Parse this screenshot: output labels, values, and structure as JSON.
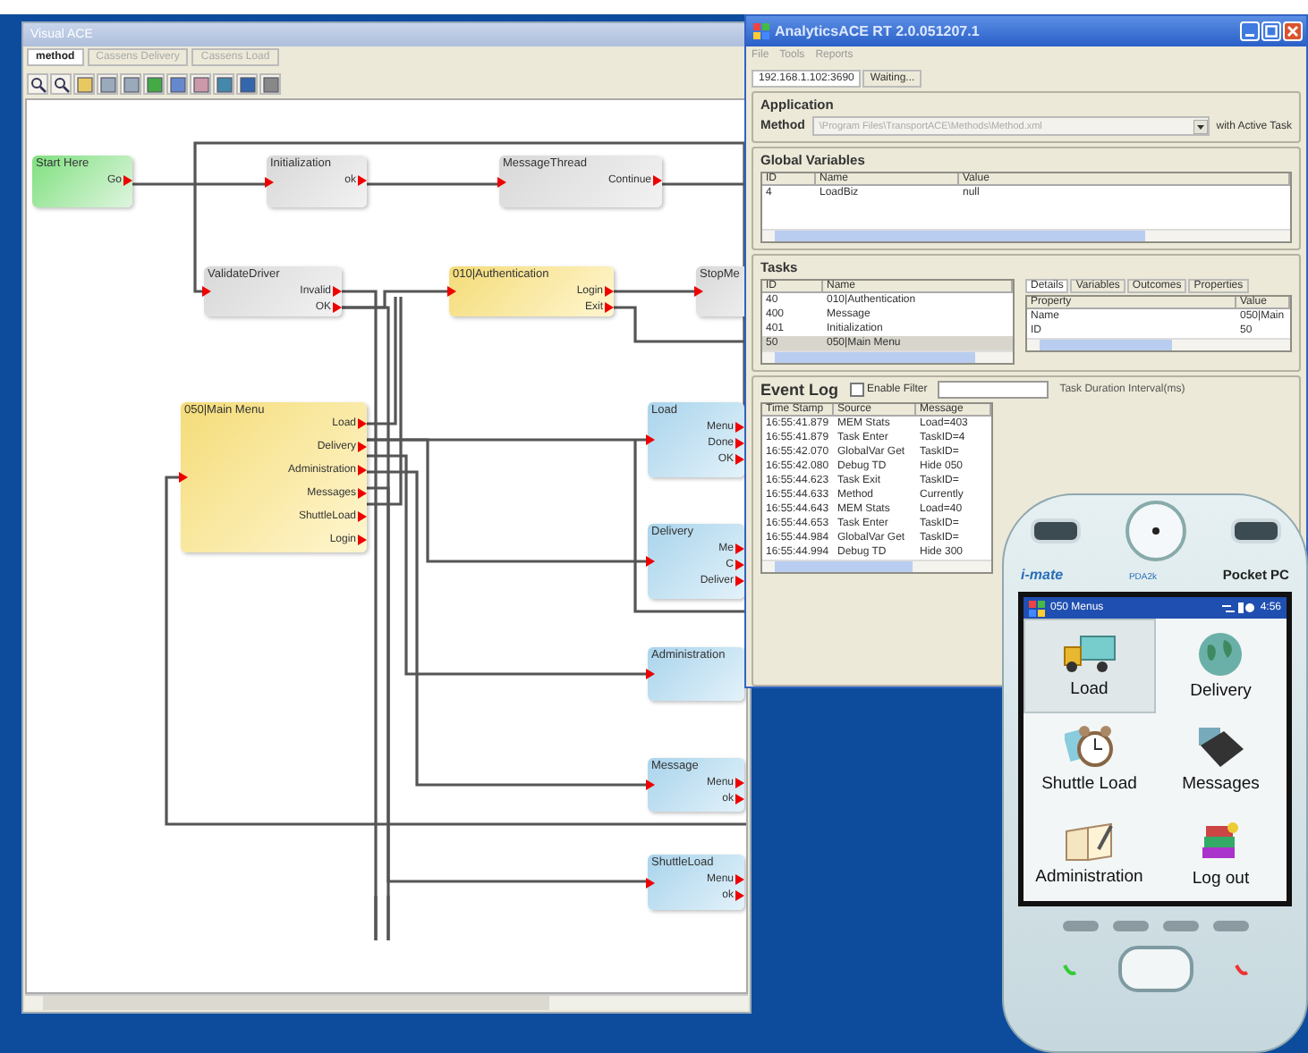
{
  "designer": {
    "title": "Visual ACE",
    "tabs": [
      {
        "label": "method",
        "selected": true
      },
      {
        "label": "Cassens Delivery",
        "selected": false
      },
      {
        "label": "Cassens Load",
        "selected": false
      }
    ],
    "nodes": [
      {
        "title": "Start Here",
        "kind": "start",
        "ports": [
          "Go"
        ]
      },
      {
        "title": "Initialization",
        "kind": "task",
        "ports": [
          "ok"
        ]
      },
      {
        "title": "MessageThread",
        "kind": "task",
        "ports": [
          "Continue"
        ]
      },
      {
        "title": "ValidateDriver",
        "kind": "task",
        "ports": [
          "Invalid",
          "OK"
        ]
      },
      {
        "title": "010|Authentication",
        "kind": "menu",
        "ports": [
          "Login",
          "Exit"
        ]
      },
      {
        "title": "StopMe",
        "kind": "task"
      },
      {
        "title": "050|Main Menu",
        "kind": "menu",
        "ports": [
          "Load",
          "Delivery",
          "Administration",
          "Messages",
          "ShuttleLoad",
          "Login"
        ]
      },
      {
        "title": "Load",
        "kind": "screen",
        "ports": [
          "Menu",
          "Done",
          "OK"
        ]
      },
      {
        "title": "Delivery",
        "kind": "screen",
        "ports": [
          "Me",
          "C",
          "Deliver"
        ]
      },
      {
        "title": "Administration",
        "kind": "screen"
      },
      {
        "title": "Message",
        "kind": "screen",
        "ports": [
          "Menu",
          "ok"
        ]
      },
      {
        "title": "ShuttleLoad",
        "kind": "screen",
        "ports": [
          "Menu",
          "ok"
        ]
      }
    ]
  },
  "runtime": {
    "title": "AnalyticsACE RT 2.0.051207.1",
    "menu": [
      "File",
      "Tools",
      "Reports"
    ],
    "status_tabs": [
      {
        "label": "192.168.1.102:3690",
        "selected": true
      },
      {
        "label": "Waiting...",
        "selected": false
      }
    ],
    "application": {
      "heading": "Application",
      "method_label": "Method",
      "method_value": "\\Program Files\\TransportACE\\Methods\\Method.xml",
      "suffix": "with Active Task"
    },
    "global_variables": {
      "heading": "Global Variables",
      "columns": [
        "ID",
        "Name",
        "Value"
      ],
      "rows": [
        [
          "4",
          "LoadBiz",
          "null"
        ]
      ]
    },
    "tasks": {
      "heading": "Tasks",
      "columns": [
        "ID",
        "Name"
      ],
      "rows": [
        {
          "cells": [
            "40",
            "010|Authentication"
          ],
          "selected": false
        },
        {
          "cells": [
            "400",
            "Message"
          ],
          "selected": false
        },
        {
          "cells": [
            "401",
            "Initialization"
          ],
          "selected": false
        },
        {
          "cells": [
            "50",
            "050|Main Menu"
          ],
          "selected": true
        }
      ],
      "detail_tabs": [
        {
          "label": "Details",
          "selected": true
        },
        {
          "label": "Variables",
          "selected": false
        },
        {
          "label": "Outcomes",
          "selected": false
        },
        {
          "label": "Properties",
          "selected": false
        }
      ],
      "detail_columns": [
        "Property",
        "Value"
      ],
      "detail_rows": [
        [
          "Name",
          "050|Main"
        ],
        [
          "ID",
          "50"
        ]
      ]
    },
    "event_log": {
      "heading": "Event Log",
      "filter": {
        "label": "Enable Filter",
        "checked": false
      },
      "duration_label": "Task Duration Interval(ms)",
      "columns": [
        "Time Stamp",
        "Source",
        "Message"
      ],
      "rows": [
        [
          "16:55:41.879",
          "MEM Stats",
          "Load=403"
        ],
        [
          "16:55:41.879",
          "Task Enter",
          "TaskID=4"
        ],
        [
          "16:55:42.070",
          "GlobalVar Get",
          "TaskID="
        ],
        [
          "16:55:42.080",
          "Debug TD",
          "Hide 050"
        ],
        [
          "16:55:44.623",
          "Task Exit",
          "TaskID="
        ],
        [
          "16:55:44.633",
          "Method",
          "Currently"
        ],
        [
          "16:55:44.643",
          "MEM Stats",
          "Load=40"
        ],
        [
          "16:55:44.653",
          "Task Enter",
          "TaskID="
        ],
        [
          "16:55:44.984",
          "GlobalVar Get",
          "TaskID="
        ],
        [
          "16:55:44.994",
          "Debug TD",
          "Hide 300"
        ]
      ]
    }
  },
  "device": {
    "brand": "i-mate",
    "model": "PDA2k",
    "platform": "Pocket PC",
    "screen_title": "050 Menus",
    "time": "4:56",
    "menu_items": [
      {
        "label": "Load",
        "selected": true
      },
      {
        "label": "Delivery",
        "selected": false
      },
      {
        "label": "Shuttle Load",
        "selected": false
      },
      {
        "label": "Messages",
        "selected": false
      },
      {
        "label": "Administration",
        "selected": false
      },
      {
        "label": "Log out",
        "selected": false
      }
    ]
  }
}
